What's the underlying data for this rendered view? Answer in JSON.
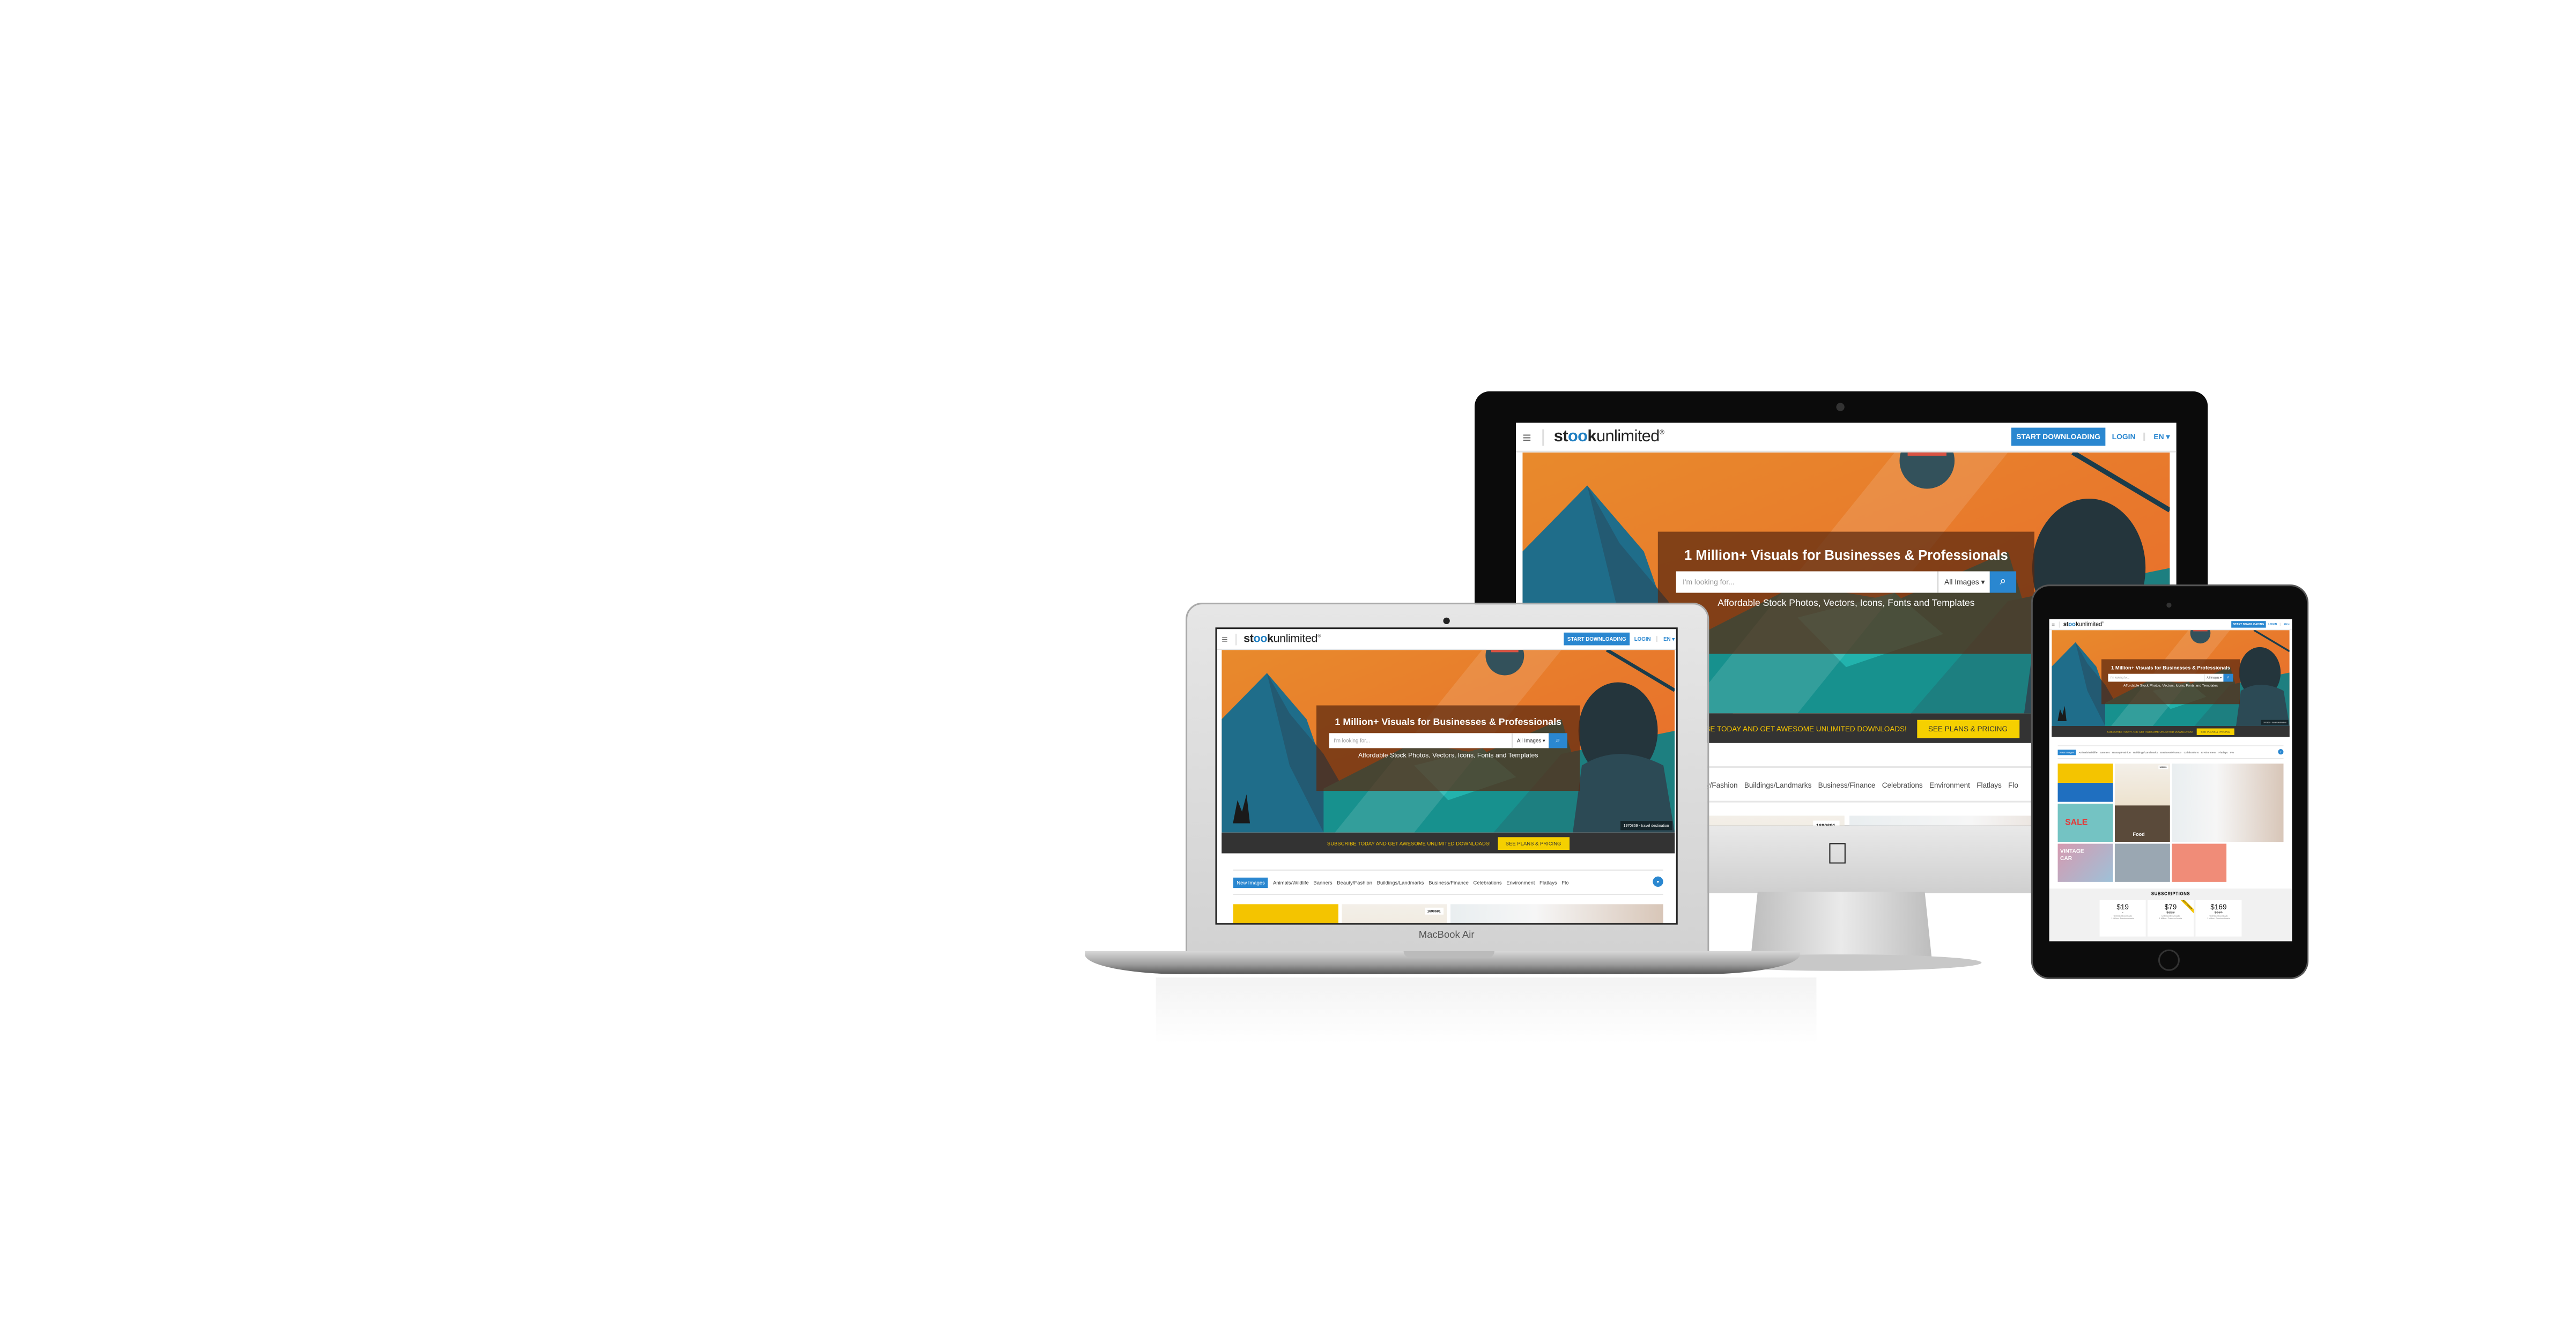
{
  "devices": {
    "laptop_label": "MacBook Air"
  },
  "site": {
    "logo_pre": "st",
    "logo_oo": "oo",
    "logo_k": "k",
    "logo_post": "unlimited",
    "logo_tm": "®",
    "menu_icon": "≡",
    "start_downloading": "START DOWNLOADING",
    "login": "LOGIN",
    "language": "EN ▾",
    "hero_title": "1 Million+ Visuals for Businesses & Professionals",
    "search_placeholder": "I'm looking for...",
    "search_filter": "All Images ▾",
    "search_icon": "⌕",
    "hero_subtitle": "Affordable Stock Photos, Vectors, Icons, Fonts and Templates",
    "hero_credit": "1970869 - travel destination",
    "banner_text": "SUBSCRIBE TODAY AND GET AWESOME UNLIMITED DOWNLOADS!",
    "banner_button": "SEE PLANS & PRICING",
    "categories": [
      "New Images",
      "Animals/Wildlife",
      "Banners",
      "Beauty/Fashion",
      "Buildings/Landmarks",
      "Business/Finance",
      "Celebrations",
      "Environment",
      "Flatlays",
      "Flo"
    ],
    "category_more": "▾",
    "tiles": {
      "food_id": "1690691",
      "vintage": "VINTAGE CAR",
      "food": "Food",
      "sale": "SALE"
    },
    "subscriptions": {
      "title": "SUBSCRIPTIONS",
      "plans": [
        {
          "price": "$19",
          "old": "",
          "line1": "Unlimited Downloads",
          "line2": "1 Million+ Premium Assets"
        },
        {
          "price": "$79",
          "old": "$228",
          "line1": "Unlimited Downloads",
          "line2": "1 Million+ Premium Assets",
          "badge": "MOST POPULAR"
        },
        {
          "price": "$169",
          "old": "$684",
          "line1": "Unlimited Downloads",
          "line2": "1 Million+ Premium Assets"
        }
      ]
    }
  }
}
